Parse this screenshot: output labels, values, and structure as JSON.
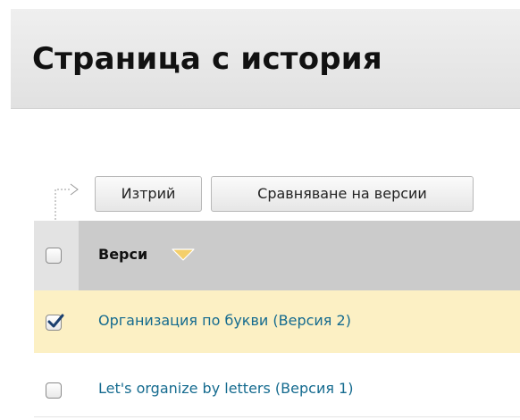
{
  "page": {
    "title": "Страница с история"
  },
  "toolbar": {
    "delete_label": "Изтрий",
    "compare_label": "Сравняване на версии"
  },
  "grid": {
    "select_all_checked": false,
    "column_title": "Верси",
    "sort_icon": "chevron-down-icon",
    "rows": [
      {
        "label": "Организация по букви (Версия 2)",
        "checked": true
      },
      {
        "label": "Let's organize by letters (Версия 1)",
        "checked": false
      }
    ]
  },
  "colors": {
    "link": "#156b8f",
    "selected_row": "#fcf0c4",
    "header": "#cbcbcb",
    "sort_icon": "#f4cf6b"
  }
}
